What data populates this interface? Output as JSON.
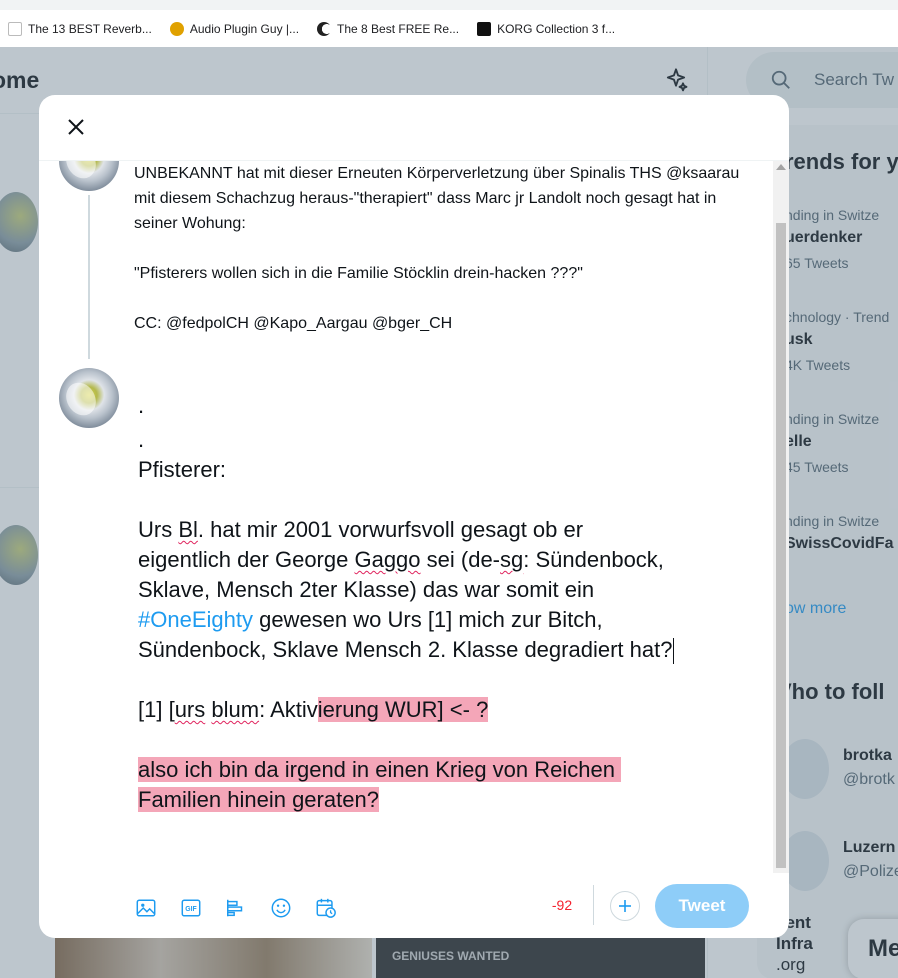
{
  "bookmarks": [
    {
      "label": "The 13 BEST Reverb...",
      "icon": "page-icon",
      "color": "#ffffff"
    },
    {
      "label": "Audio Plugin Guy |...",
      "icon": "audio-plugin-guy-icon",
      "color": "#e0a100"
    },
    {
      "label": "The 8 Best FREE Re...",
      "icon": "moon-icon",
      "color": "#222222"
    },
    {
      "label": "KORG Collection 3 f...",
      "icon": "korg-icon",
      "color": "#111111"
    }
  ],
  "background": {
    "home_title": "ome",
    "search_placeholder": "Search Tw",
    "trends_title": "rends for y",
    "trends": [
      {
        "meta": "nding in Switze",
        "name": "uerdenker",
        "count": "65 Tweets"
      },
      {
        "meta": "chnology · Trend",
        "name": "usk",
        "count": "4K Tweets"
      },
      {
        "meta": "nding in Switze",
        "name": "elle",
        "count": "45 Tweets"
      },
      {
        "meta": "nding in Switze",
        "name": "SwissCovidFa",
        "count": ""
      }
    ],
    "show_more": "ow more",
    "who_title": "Vho to foll",
    "who": [
      {
        "name": "brotka",
        "handle": "@brotk"
      },
      {
        "name": "Luzern",
        "handle": "@Polize"
      }
    ],
    "wave_text": "vent Infra",
    "wave_org": ".org",
    "geniuses": "GENIUSES WANTED",
    "message_label": "Me"
  },
  "modal": {
    "quoted_text": "UNBEKANNT hat mit dieser Erneuten Körperverletzung über Spinalis THS @ksaarau mit diesem Schachzug heraus-\"therapiert\" dass Marc jr Landolt noch gesagt hat in seiner Wohung:\n\n\"Pfisterers wollen sich in die Familie Stöcklin drein-hacken ???\"\n\nCC: @fedpolCH @Kapo_Aargau @bger_CH",
    "composer": {
      "line_dot1": ".",
      "line_dot2": ".",
      "line_pfisterer": "Pfisterer:",
      "p1a": "Urs ",
      "p1b": "Bl",
      "p1c": ". hat mir 2001 vorwurfsvoll gesagt ob er",
      "p2a": "eigentlich der George ",
      "p2b": "Gaggo",
      "p2c": " sei (de-",
      "p2d": "sg",
      "p2e": ": Sündenbock,",
      "p3": "Sklave, Mensch 2ter Klasse) das war somit ein",
      "p4_hashtag": "#OneEighty",
      "p4_rest": " gewesen wo Urs [1] mich zur Bitch,",
      "p5": "Sündenbock, Sklave Mensch 2. Klasse degradiert hat?",
      "r1a": "[1] [",
      "r1b": "urs",
      "r1c": " ",
      "r1d": "blum",
      "r1e": ": Aktiv",
      "r1f": "ierung WUR] <- ?",
      "k1": "also ich bin da irgend in einen Krieg von Reichen ",
      "k2": "Familien hinein geraten?"
    },
    "char_count": "-92",
    "tweet_label": "Tweet",
    "colors": {
      "accent": "#1d9bf0",
      "tweet_disabled": "#8ecdf8",
      "highlight": "#f4a6b8",
      "over_limit": "#f4212e"
    }
  }
}
